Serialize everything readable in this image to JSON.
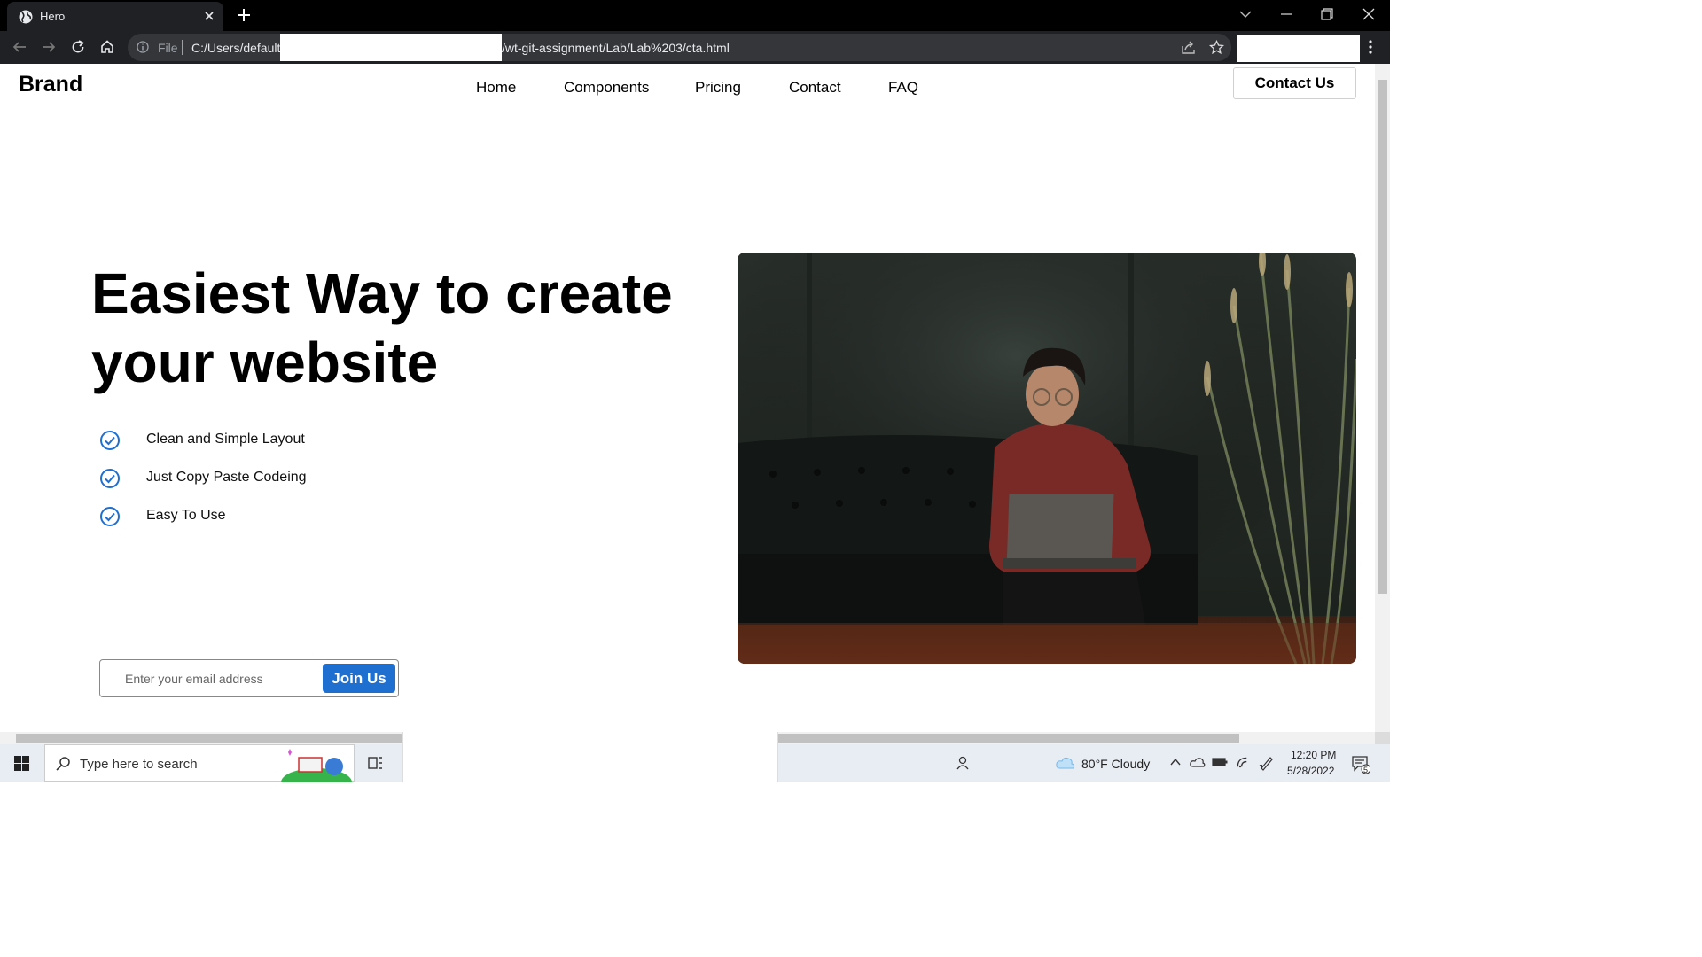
{
  "browser": {
    "tab_title": "Hero",
    "omnibox": {
      "scheme_label": "File",
      "url_prefix": "C:/Users/default",
      "url_suffix": "/wt-git-assignment/Lab/Lab%203/cta.html"
    }
  },
  "site": {
    "brand": "Brand",
    "nav": [
      "Home",
      "Components",
      "Pricing",
      "Contact",
      "FAQ"
    ],
    "contact_button": "Contact Us"
  },
  "hero": {
    "headline_line1": "Easiest Way to create",
    "headline_line2": "your website",
    "features": [
      "Clean and Simple Layout",
      "Just Copy Paste Codeing",
      "Easy To Use"
    ],
    "email_placeholder": "Enter your email address",
    "join_button": "Join Us",
    "accent_color": "#1f6fd1"
  },
  "taskbar": {
    "search_placeholder": "Type here to search",
    "weather": "80°F  Cloudy",
    "time": "12:20 PM",
    "date": "5/28/2022",
    "notification_count": "5"
  }
}
